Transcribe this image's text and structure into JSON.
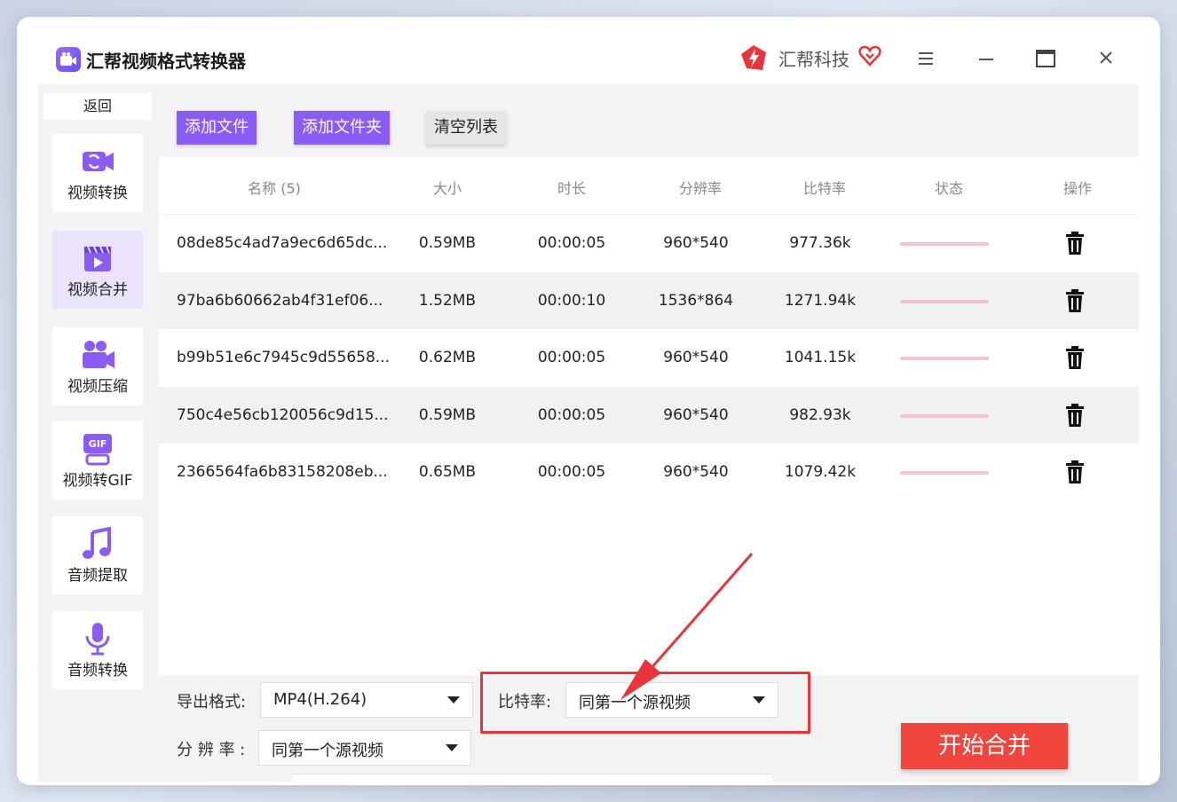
{
  "app": {
    "title": "汇帮视频格式转换器",
    "brand": "汇帮科技"
  },
  "sidebar": {
    "back_label": "返回",
    "items": [
      {
        "label": "视频转换",
        "icon": "video-convert-icon"
      },
      {
        "label": "视频合并",
        "icon": "video-merge-icon",
        "active": true
      },
      {
        "label": "视频压缩",
        "icon": "video-compress-icon"
      },
      {
        "label": "视频转GIF",
        "icon": "gif-icon"
      },
      {
        "label": "音频提取",
        "icon": "music-note-icon"
      },
      {
        "label": "音频转换",
        "icon": "microphone-icon"
      }
    ]
  },
  "toolbar": {
    "add_file": "添加文件",
    "add_folder": "添加文件夹",
    "clear_list": "清空列表"
  },
  "table": {
    "headers": [
      "名称 (5)",
      "大小",
      "时长",
      "分辨率",
      "比特率",
      "状态",
      "操作"
    ],
    "rows": [
      {
        "name": "08de85c4ad7a9ec6d65dc...",
        "size": "0.59MB",
        "duration": "00:00:05",
        "resolution": "960*540",
        "bitrate": "977.36k"
      },
      {
        "name": "97ba6b60662ab4f31ef06...",
        "size": "1.52MB",
        "duration": "00:00:10",
        "resolution": "1536*864",
        "bitrate": "1271.94k"
      },
      {
        "name": "b99b51e6c7945c9d55658...",
        "size": "0.62MB",
        "duration": "00:00:05",
        "resolution": "960*540",
        "bitrate": "1041.15k"
      },
      {
        "name": "750c4e56cb120056c9d15...",
        "size": "0.59MB",
        "duration": "00:00:05",
        "resolution": "960*540",
        "bitrate": "982.93k"
      },
      {
        "name": "2366564fa6b83158208eb...",
        "size": "0.65MB",
        "duration": "00:00:05",
        "resolution": "960*540",
        "bitrate": "1079.42k"
      }
    ]
  },
  "settings": {
    "format_label": "导出格式:",
    "format_value": "MP4(H.264)",
    "bitrate_label": "比特率:",
    "bitrate_value": "同第一个源视频",
    "resolution_label": "分 辨 率 :",
    "resolution_value": "同第一个源视频",
    "start_button": "开始合并"
  },
  "colors": {
    "accent": "#8a5cf5",
    "start": "#f0453d",
    "highlight": "#e8343a",
    "status": "#f3c4d0"
  }
}
